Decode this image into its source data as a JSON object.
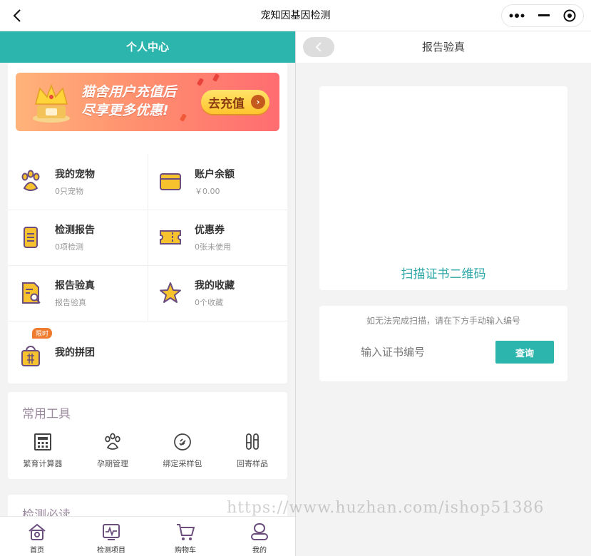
{
  "app": {
    "title": "宠知因基因检测"
  },
  "left": {
    "header": "个人中心",
    "banner": {
      "line1": "猫舍用户充值后",
      "line2": "尽享更多优惠!",
      "cta": "去充值"
    },
    "grid": [
      {
        "title": "我的宠物",
        "sub": "0只宠物",
        "icon": "paw-icon"
      },
      {
        "title": "账户余额",
        "sub": "￥0.00",
        "icon": "wallet-icon"
      },
      {
        "title": "检测报告",
        "sub": "0项检测",
        "icon": "report-icon"
      },
      {
        "title": "优惠券",
        "sub": "0张未使用",
        "icon": "coupon-icon"
      },
      {
        "title": "报告验真",
        "sub": "报告验真",
        "icon": "verify-icon"
      },
      {
        "title": "我的收藏",
        "sub": "0个收藏",
        "icon": "star-icon"
      },
      {
        "title": "我的拼团",
        "sub": "",
        "icon": "group-bag-icon",
        "badge": "限时"
      }
    ],
    "tools": {
      "title": "常用工具",
      "items": [
        {
          "label": "繁育计算器",
          "icon": "calculator-icon"
        },
        {
          "label": "孕期管理",
          "icon": "paw-outline-icon"
        },
        {
          "label": "绑定采样包",
          "icon": "link-icon"
        },
        {
          "label": "回寄样品",
          "icon": "test-tube-icon"
        }
      ]
    },
    "reading": {
      "title": "检测必读"
    },
    "tabbar": [
      {
        "label": "首页",
        "icon": "home-icon"
      },
      {
        "label": "检测项目",
        "icon": "monitor-icon"
      },
      {
        "label": "购物车",
        "icon": "cart-icon"
      },
      {
        "label": "我的",
        "icon": "user-icon"
      }
    ]
  },
  "right": {
    "header": "报告验真",
    "scan_link": "扫描证书二维码",
    "hint": "如无法完成扫描，请在下方手动输入编号",
    "input_placeholder": "输入证书编号",
    "query_button": "查询"
  },
  "watermark": "https://www.huzhan.com/ishop51386",
  "colors": {
    "primary": "#2cb5ad",
    "icon_purple": "#6b4e7d",
    "icon_yellow": "#f6c22e"
  }
}
